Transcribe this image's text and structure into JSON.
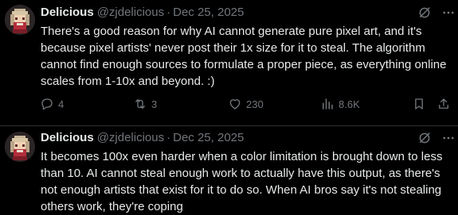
{
  "colors": {
    "background": "#000000",
    "text_primary": "#e7e9ea",
    "text_secondary": "#71767b",
    "divider": "#2f3336"
  },
  "tweets": [
    {
      "author_name": "Delicious",
      "handle": "@zjdelicious",
      "separator": "·",
      "date": "Dec 25, 2025",
      "text": "There's a good reason for why AI cannot generate pure pixel art, and it's because pixel artists' never post their 1x size for it to steal. The algorithm cannot find enough sources to formulate a proper piece, as everything online scales from 1-10x and beyond. :)",
      "stats": {
        "replies": "4",
        "reposts": "3",
        "likes": "230",
        "views": "8.6K"
      }
    },
    {
      "author_name": "Delicious",
      "handle": "@zjdelicious",
      "separator": "·",
      "date": "Dec 25, 2025",
      "text": "It becomes 100x even harder when a color limitation is brought down to less than 10. AI cannot steal enough work to actually have this output, as there's not enough artists that exist for it to do so. When AI bros say it's not stealing others work, they're coping"
    }
  ],
  "icons": {
    "grok": "grok-slash-icon",
    "more": "more-dots-icon",
    "reply": "reply-icon",
    "repost": "repost-icon",
    "like": "heart-icon",
    "views": "views-icon",
    "bookmark": "bookmark-icon",
    "share": "share-icon"
  }
}
